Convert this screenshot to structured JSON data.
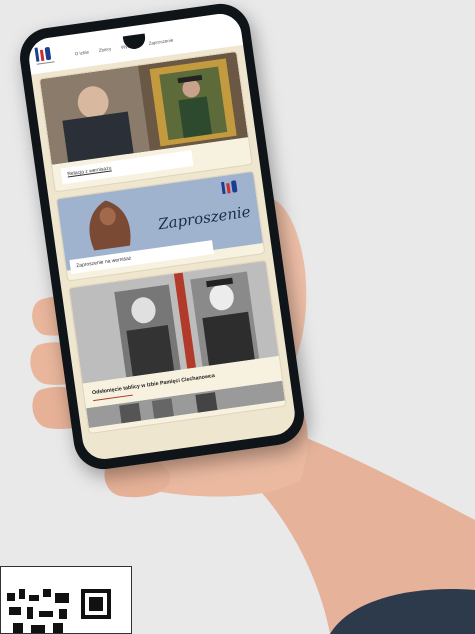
{
  "site": {
    "nav": [
      "O Izbie",
      "Zbiory",
      "Wystawy",
      "Zaproszenie"
    ]
  },
  "cards": [
    {
      "caption": "Relacja z wernisażu"
    },
    {
      "title": "Zaproszenie",
      "caption": "Zaproszenie na wernisaż"
    },
    {
      "caption": "Odsłonięcie tablicy w Izbie Pamięci Ciechanowca"
    }
  ],
  "colors": {
    "background": "#e9e9ea",
    "phone": "#0f1419",
    "accent": "#b23a2a"
  }
}
